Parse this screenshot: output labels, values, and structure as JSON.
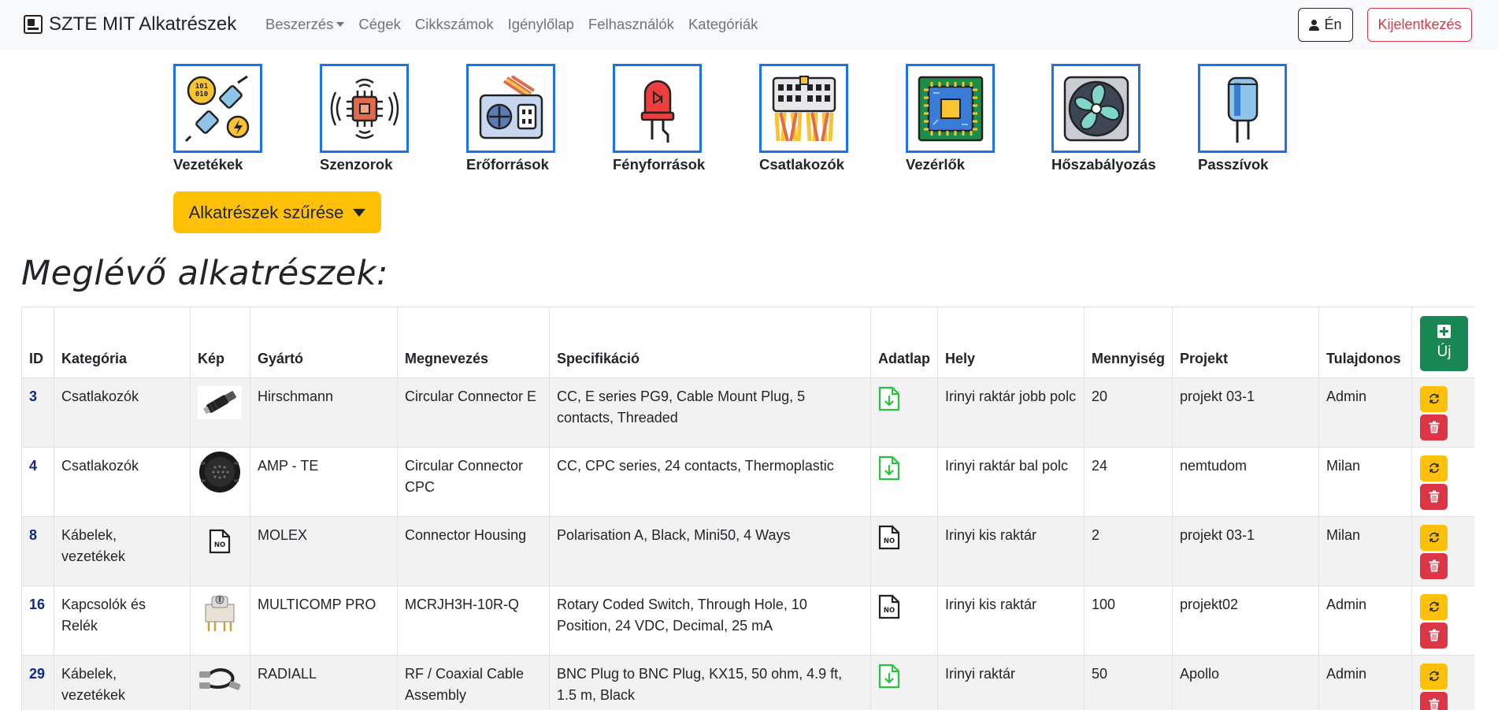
{
  "navbar": {
    "brand": "SZTE MIT Alkatrészek",
    "links": [
      "Beszerzés",
      "Cégek",
      "Cikkszámok",
      "Igénylőlap",
      "Felhasználók",
      "Kategóriák"
    ],
    "me_label": "Én",
    "logout_label": "Kijelentkezés"
  },
  "categories": [
    {
      "label": "Vezetékek",
      "icon": "cable-icon"
    },
    {
      "label": "Szenzorok",
      "icon": "sensor-icon"
    },
    {
      "label": "Erőforrások",
      "icon": "power-supply-icon"
    },
    {
      "label": "Fényforrások",
      "icon": "led-icon"
    },
    {
      "label": "Csatlakozók",
      "icon": "connector-icon"
    },
    {
      "label": "Vezérlők",
      "icon": "microcontroller-icon"
    },
    {
      "label": "Hőszabályozás",
      "icon": "fan-icon"
    },
    {
      "label": "Passzívok",
      "icon": "capacitor-icon"
    }
  ],
  "filter_button": "Alkatrészek szűrése",
  "page_title": "Meglévő alkatrészek:",
  "table": {
    "headers": [
      "ID",
      "Kategória",
      "Kép",
      "Gyártó",
      "Megnevezés",
      "Specifikáció",
      "Adatlap",
      "Hely",
      "Mennyiség",
      "Projekt",
      "Tulajdonos"
    ],
    "new_button": "Új",
    "rows": [
      {
        "id": "3",
        "kategoria": "Csatlakozók",
        "kep": "circular-connector-photo",
        "gyarto": "Hirschmann",
        "megnevezes": "Circular Connector E",
        "spec": "CC, E series PG9, Cable Mount Plug, 5 contacts, Threaded",
        "adatlap": "download-icon",
        "hely": "Irinyi raktár jobb polc",
        "mennyiseg": "20",
        "projekt": "projekt 03-1",
        "tulajdonos": "Admin"
      },
      {
        "id": "4",
        "kategoria": "Csatlakozók",
        "kep": "cpc-connector-photo",
        "gyarto": "AMP - TE",
        "megnevezes": "Circular Connector CPC",
        "spec": "CC, CPC series, 24 contacts, Thermoplastic",
        "adatlap": "download-icon",
        "hely": "Irinyi raktár bal polc",
        "mennyiseg": "24",
        "projekt": "nemtudom",
        "tulajdonos": "Milan"
      },
      {
        "id": "8",
        "kategoria": "Kábelek, vezetékek",
        "kep": "no-file-icon",
        "gyarto": "MOLEX",
        "megnevezes": "Connector Housing",
        "spec": "Polarisation A, Black, Mini50, 4 Ways",
        "adatlap": "no-file-icon",
        "hely": "Irinyi kis raktár",
        "mennyiseg": "2",
        "projekt": "projekt 03-1",
        "tulajdonos": "Milan"
      },
      {
        "id": "16",
        "kategoria": "Kapcsolók és Relék",
        "kep": "rotary-switch-photo",
        "gyarto": "MULTICOMP PRO",
        "megnevezes": "MCRJH3H-10R-Q",
        "spec": "Rotary Coded Switch, Through Hole, 10 Position, 24 VDC, Decimal, 25 mA",
        "adatlap": "no-file-icon",
        "hely": "Irinyi kis raktár",
        "mennyiseg": "100",
        "projekt": "projekt02",
        "tulajdonos": "Admin"
      },
      {
        "id": "29",
        "kategoria": "Kábelek, vezetékek",
        "kep": "bnc-cable-photo",
        "gyarto": "RADIALL",
        "megnevezes": "RF / Coaxial Cable Assembly",
        "spec": "BNC Plug to BNC Plug, KX15, 50 ohm, 4.9 ft, 1.5 m, Black",
        "adatlap": "download-icon",
        "hely": "Irinyi raktár",
        "mennyiseg": "50",
        "projekt": "Apollo",
        "tulajdonos": "Admin"
      }
    ]
  },
  "no_file_text": "NO",
  "colors": {
    "accent": "#1a73e8",
    "filter": "#ffc107",
    "new": "#198754",
    "delete": "#dc3545",
    "download": "#28c23c"
  }
}
